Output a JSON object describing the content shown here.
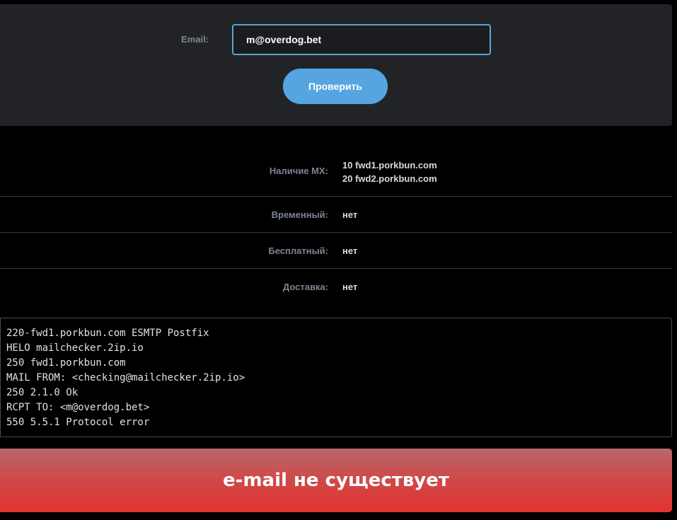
{
  "form": {
    "email_label": "Email:",
    "email_value": "m@overdog.bet",
    "check_button_label": "Проверить"
  },
  "results": {
    "mx_label": "Наличие MX:",
    "mx_records": [
      "10 fwd1.porkbun.com",
      "20 fwd2.porkbun.com"
    ],
    "temporary_label": "Временный:",
    "temporary_value": "нет",
    "free_label": "Бесплатный:",
    "free_value": "нет",
    "delivery_label": "Доставка:",
    "delivery_value": "нет"
  },
  "smtp_log": [
    "220-fwd1.porkbun.com ESMTP Postfix",
    "HELO mailchecker.2ip.io",
    "250 fwd1.porkbun.com",
    "MAIL FROM: <checking@mailchecker.2ip.io>",
    "250 2.1.0 Ok",
    "RCPT TO: <m@overdog.bet>",
    "550 5.5.1 Protocol error"
  ],
  "status": {
    "message": "e-mail не существует"
  },
  "colors": {
    "accent": "#57a5e0",
    "error": "#e3322d",
    "panel": "#222326"
  }
}
